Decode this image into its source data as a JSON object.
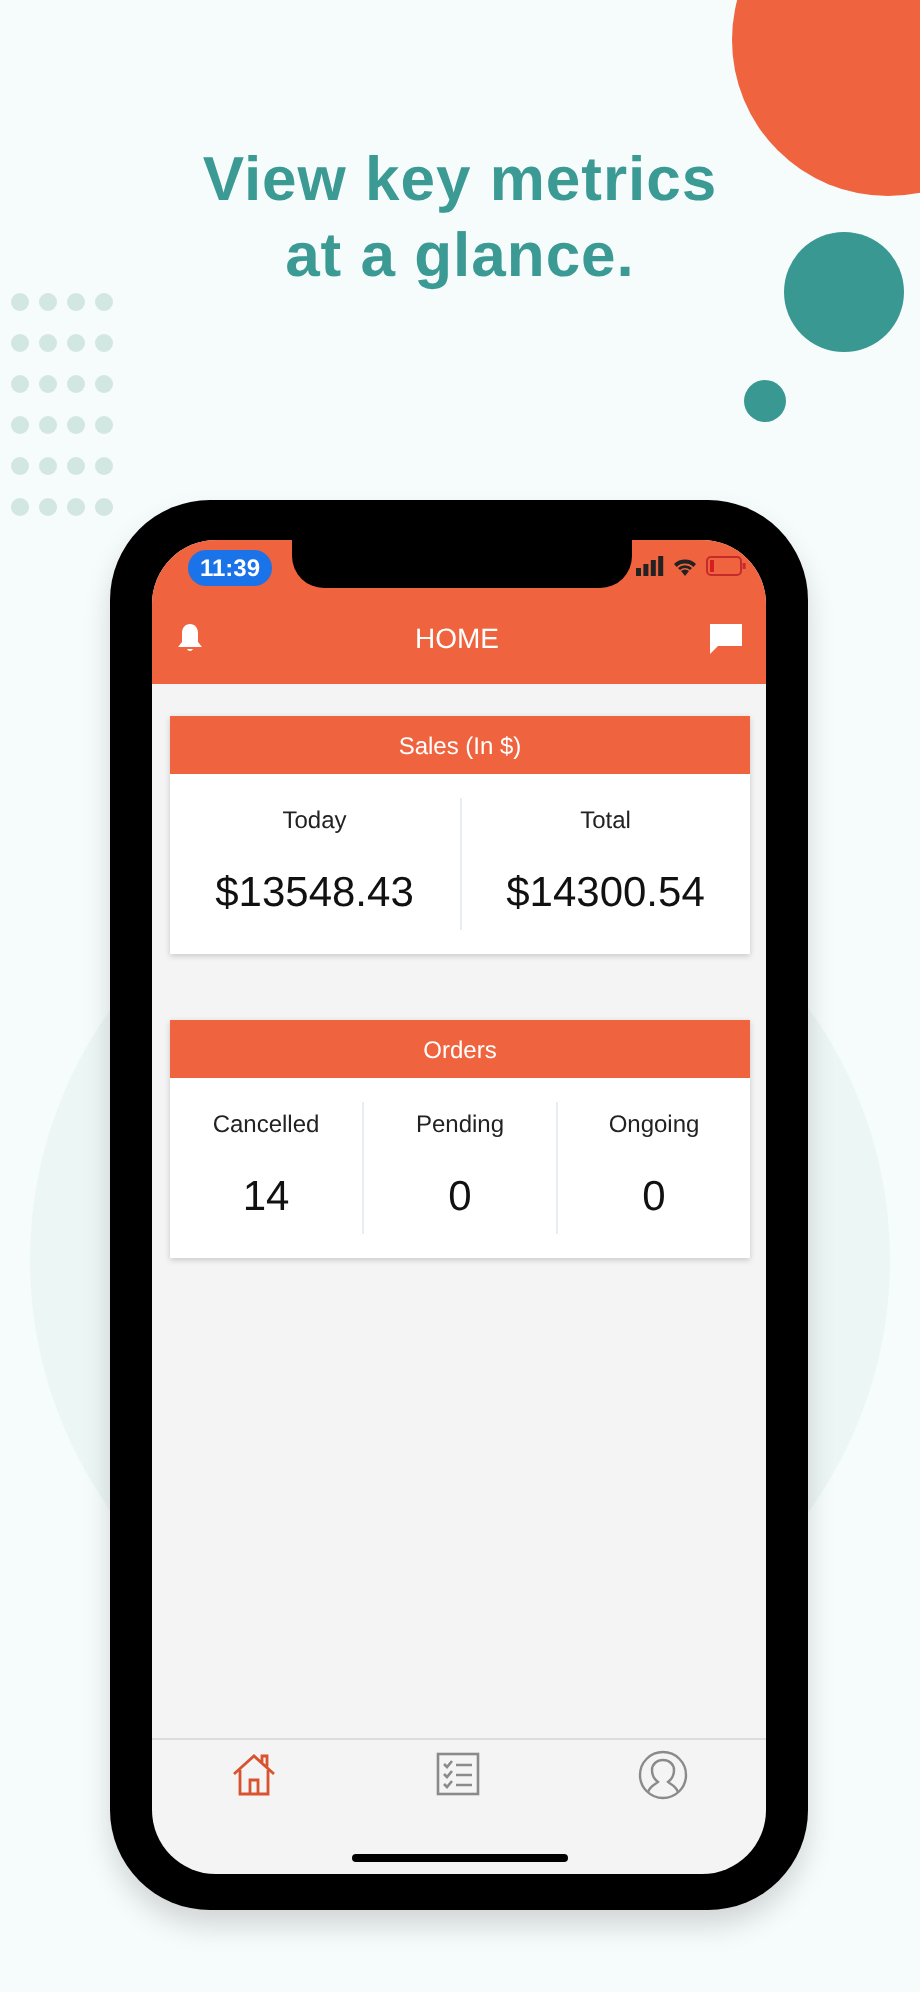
{
  "headline": [
    "View key metrics",
    "at a glance."
  ],
  "status_bar": {
    "time": "11:39"
  },
  "app_bar": {
    "title": "HOME"
  },
  "cards": [
    {
      "title": "Sales (In $)",
      "metrics": [
        {
          "label": "Today",
          "value": "$13548.43"
        },
        {
          "label": "Total",
          "value": "$14300.54"
        }
      ]
    },
    {
      "title": "Orders",
      "metrics": [
        {
          "label": "Cancelled",
          "value": "14"
        },
        {
          "label": "Pending",
          "value": "0"
        },
        {
          "label": "Ongoing",
          "value": "0"
        }
      ]
    }
  ],
  "tabs": [
    {
      "kind": "home",
      "selected": true
    },
    {
      "kind": "list",
      "selected": false
    },
    {
      "kind": "profile",
      "selected": false
    }
  ]
}
